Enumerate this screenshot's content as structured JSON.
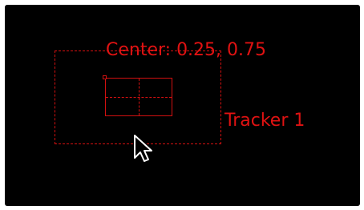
{
  "viewer": {
    "background": "#000000",
    "accent_color": "#e01212"
  },
  "tracker": {
    "center_label": "Center: 0.25, 0.75",
    "name_label": "Tracker 1"
  },
  "cursor": {
    "icon": "mouse-pointer-icon"
  }
}
